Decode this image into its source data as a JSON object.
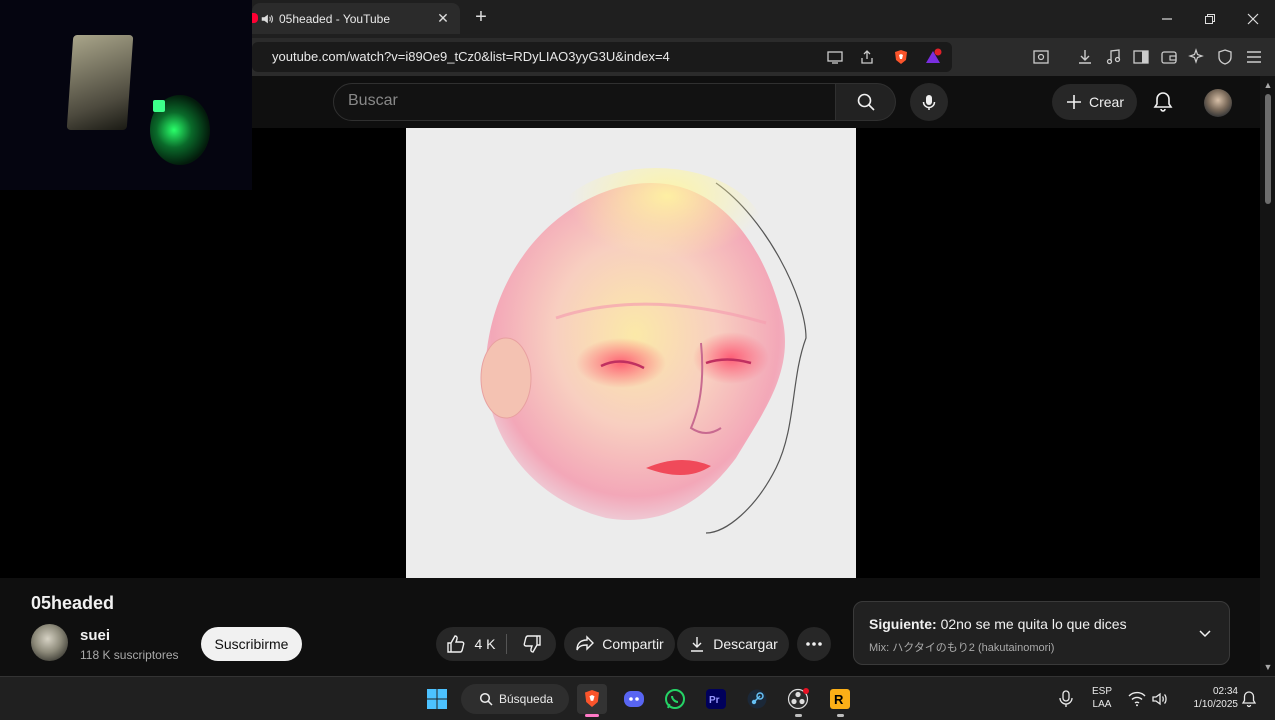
{
  "browser": {
    "tab_title": "05headed - YouTube",
    "url": "youtube.com/watch?v=i89Oe9_tCz0&list=RDyLIAO3yyG3U&index=4"
  },
  "youtube": {
    "search_placeholder": "Buscar",
    "create_label": "Crear"
  },
  "video": {
    "title": "05headed",
    "channel": {
      "name": "suei",
      "subscribers": "118 K suscriptores"
    },
    "subscribe_label": "Suscribirme",
    "likes": "4 K",
    "share_label": "Compartir",
    "download_label": "Descargar",
    "next": {
      "prefix": "Siguiente:",
      "title": "02no se me quita lo que dices",
      "mix": "Mix: ハクタイのもり2 (hakutainomori)"
    }
  },
  "taskbar": {
    "search_label": "Búsqueda",
    "language": "ESP",
    "layout": "LAA",
    "time": "02:34",
    "date": "1/10/2025"
  },
  "colors": {
    "background": "#0f0f0f",
    "accent_red": "#ff0033"
  }
}
